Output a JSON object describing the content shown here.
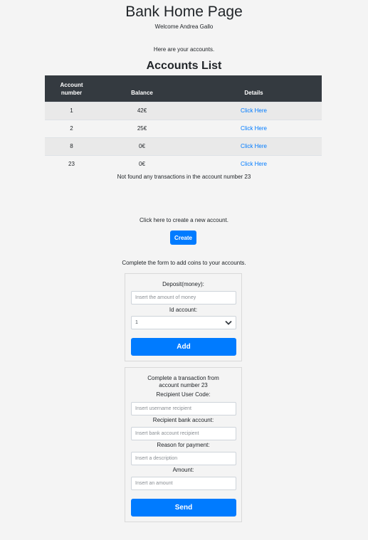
{
  "page": {
    "title": "Bank Home Page",
    "welcome": "Welcome Andrea Gallo",
    "accounts_intro": "Here are your accounts.",
    "list_heading": "Accounts List"
  },
  "accounts_table": {
    "headers": [
      "Account number",
      "Balance",
      "Details"
    ],
    "rows": [
      {
        "number": "1",
        "balance": "42€",
        "details": "Click Here"
      },
      {
        "number": "2",
        "balance": "25€",
        "details": "Click Here"
      },
      {
        "number": "8",
        "balance": "0€",
        "details": "Click Here"
      },
      {
        "number": "23",
        "balance": "0€",
        "details": "Click Here"
      }
    ]
  },
  "not_found_message": "Not found any transactions in the account number 23",
  "create_section": {
    "intro": "Click here to create a new account.",
    "button_label": "Create"
  },
  "deposit_form": {
    "intro": "Complete the form to add coins to your accounts.",
    "deposit_label": "Deposit(money):",
    "deposit_placeholder": "Insert the amount of money",
    "id_label": "Id account:",
    "id_selected": "1",
    "button_label": "Add"
  },
  "transaction_form": {
    "title": "Complete a transaction from account number 23",
    "recipient_code_label": "Recipient User Code:",
    "recipient_code_placeholder": "Insert username recipient",
    "recipient_account_label": "Recipient bank account:",
    "recipient_account_placeholder": "Insert bank account recipient",
    "reason_label": "Reason for payment:",
    "reason_placeholder": "Insert a description",
    "amount_label": "Amount:",
    "amount_placeholder": "Insert an amount",
    "button_label": "Send"
  },
  "colors": {
    "primary": "#007bff",
    "table_header": "#343a40",
    "background": "#f4f4f4"
  }
}
